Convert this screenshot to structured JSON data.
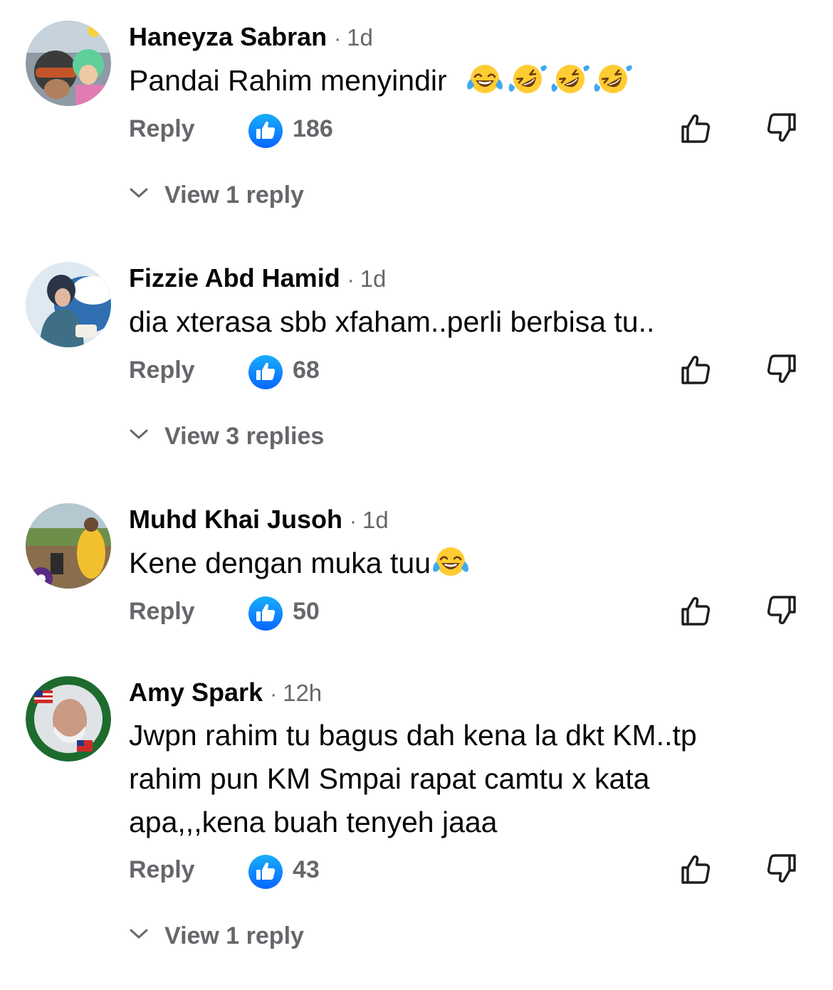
{
  "comments": [
    {
      "author": "Haneyza Sabran",
      "time": "1d",
      "text": "Pandai Rahim menyindir",
      "emojis": [
        "joy",
        "rofl",
        "rofl",
        "rofl"
      ],
      "reply_label": "Reply",
      "likes": "186",
      "view_replies": "View 1 reply"
    },
    {
      "author": "Fizzie Abd Hamid",
      "time": "1d",
      "text": "dia xterasa sbb xfaham..perli berbisa tu..",
      "emojis": [],
      "reply_label": "Reply",
      "likes": "68",
      "view_replies": "View 3 replies"
    },
    {
      "author": "Muhd Khai Jusoh",
      "time": "1d",
      "text": "Kene dengan muka tuu",
      "emojis": [
        "joy"
      ],
      "reply_label": "Reply",
      "likes": "50",
      "view_replies": ""
    },
    {
      "author": "Amy Spark",
      "time": "12h",
      "text_lines": [
        "Jwpn rahim tu bagus dah kena la dkt KM..tp",
        "rahim pun KM Smpai rapat camtu x kata",
        "apa,,,kena buah tenyeh jaaa"
      ],
      "emojis": [],
      "reply_label": "Reply",
      "likes": "43",
      "view_replies": "View 1 reply"
    }
  ],
  "separator": "·",
  "colors": {
    "text": "#050505",
    "secondary": "#65676b",
    "like_blue": "#1877f2"
  },
  "icons": [
    "like-badge-icon",
    "thumbs-up-icon",
    "thumbs-down-icon",
    "chevron-down-icon",
    "joy-emoji-icon",
    "rofl-emoji-icon"
  ]
}
